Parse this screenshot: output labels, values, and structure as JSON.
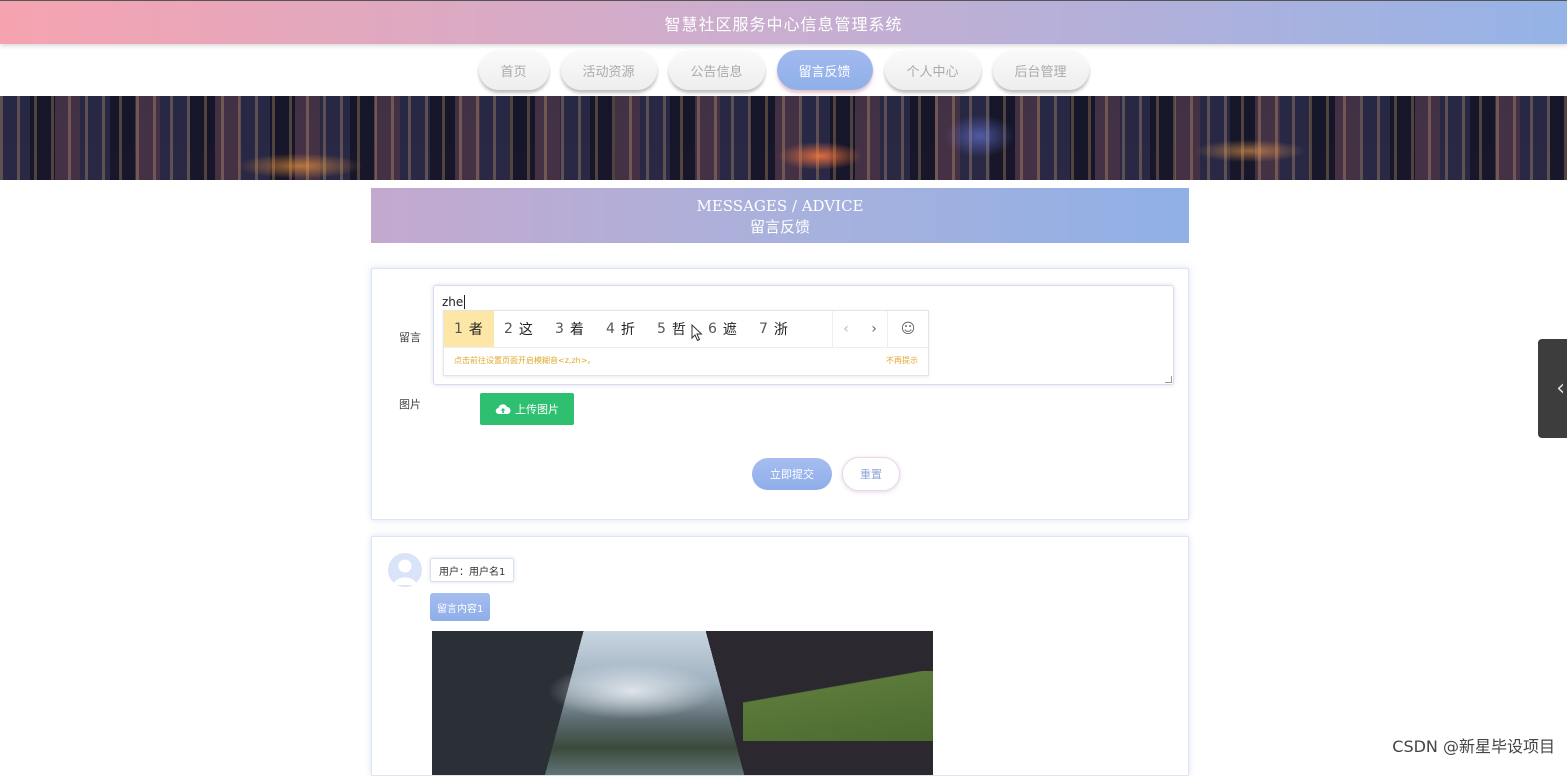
{
  "header": {
    "title": "智慧社区服务中心信息管理系统"
  },
  "nav": {
    "items": [
      {
        "label": "首页"
      },
      {
        "label": "活动资源"
      },
      {
        "label": "公告信息"
      },
      {
        "label": "留言反馈",
        "active": true
      },
      {
        "label": "个人中心"
      },
      {
        "label": "后台管理"
      }
    ]
  },
  "section": {
    "title_en": "MESSAGES / ADVICE",
    "title_cn": "留言反馈"
  },
  "form": {
    "message_label": "留言",
    "message_value": "zhe",
    "image_label": "图片",
    "upload_label": "上传图片",
    "submit_label": "立即提交",
    "reset_label": "重置"
  },
  "ime": {
    "candidates": [
      {
        "num": "1",
        "char": "者"
      },
      {
        "num": "2",
        "char": "这"
      },
      {
        "num": "3",
        "char": "着"
      },
      {
        "num": "4",
        "char": "折"
      },
      {
        "num": "5",
        "char": "哲"
      },
      {
        "num": "6",
        "char": "遮"
      },
      {
        "num": "7",
        "char": "浙"
      }
    ],
    "prev": "‹",
    "next": "›",
    "emoji": "☺",
    "hint": "点击前往设置页面开启模糊音<z,zh>。",
    "no_hint": "不再提示"
  },
  "message": {
    "user_text": "用户：用户名1",
    "content_text": "留言内容1"
  },
  "side_tab": {
    "arrow": "‹"
  },
  "watermark": "CSDN @新星毕设项目"
}
